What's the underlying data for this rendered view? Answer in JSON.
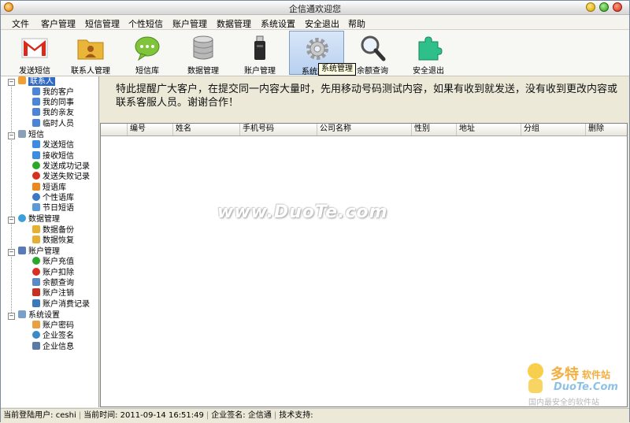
{
  "window": {
    "title": "企信通欢迎您"
  },
  "menu": [
    "文件",
    "客户管理",
    "短信管理",
    "个性短信",
    "账户管理",
    "数据管理",
    "系统设置",
    "安全退出",
    "帮助"
  ],
  "toolbar": [
    {
      "label": "发送短信",
      "icon": "gmail-m-icon"
    },
    {
      "label": "联系人管理",
      "icon": "contacts-folder-icon"
    },
    {
      "label": "短信库",
      "icon": "chat-bubble-icon"
    },
    {
      "label": "数据管理",
      "icon": "database-icon"
    },
    {
      "label": "账户管理",
      "icon": "usb-drive-icon"
    },
    {
      "label": "系统管理",
      "icon": "gear-icon"
    },
    {
      "label": "余额查询",
      "icon": "magnifier-icon"
    },
    {
      "label": "安全退出",
      "icon": "puzzle-icon"
    }
  ],
  "tooltip": "系统管理",
  "tree": {
    "groups": [
      {
        "label": "联系人",
        "icon": "contacts-group-icon",
        "children": [
          {
            "label": "我的客户",
            "icon": "person-icon"
          },
          {
            "label": "我的同事",
            "icon": "person-icon"
          },
          {
            "label": "我的亲友",
            "icon": "person-icon"
          },
          {
            "label": "临时人员",
            "icon": "person-icon"
          }
        ]
      },
      {
        "label": "短信",
        "icon": "envelope-icon",
        "children": [
          {
            "label": "发送短信",
            "icon": "send-icon"
          },
          {
            "label": "接收短信",
            "icon": "inbox-icon"
          },
          {
            "label": "发送成功记录",
            "icon": "check-icon"
          },
          {
            "label": "发送失败记录",
            "icon": "error-icon"
          },
          {
            "label": "短语库",
            "icon": "library-icon"
          },
          {
            "label": "个性语库",
            "icon": "custom-icon"
          },
          {
            "label": "节日短语",
            "icon": "calendar-icon"
          }
        ]
      },
      {
        "label": "数据管理",
        "icon": "data-icon",
        "children": [
          {
            "label": "数据备份",
            "icon": "backup-icon"
          },
          {
            "label": "数据恢复",
            "icon": "restore-icon"
          }
        ]
      },
      {
        "label": "账户管理",
        "icon": "account-icon",
        "children": [
          {
            "label": "账户充值",
            "icon": "add-icon"
          },
          {
            "label": "账户扣除",
            "icon": "minus-icon"
          },
          {
            "label": "余额查询",
            "icon": "grid-icon"
          },
          {
            "label": "账户注销",
            "icon": "cancel-icon"
          },
          {
            "label": "账户消费记录",
            "icon": "record-icon"
          }
        ]
      },
      {
        "label": "系统设置",
        "icon": "settings-icon",
        "children": [
          {
            "label": "账户密码",
            "icon": "pencil-icon"
          },
          {
            "label": "企业签名",
            "icon": "globe-icon"
          },
          {
            "label": "企业信息",
            "icon": "info-icon"
          }
        ]
      }
    ]
  },
  "notice": "特此提醒广大客户，在提交同一内容大量时，先用移动号码测试内容，如果有收到就发送，没有收到更改内容或联系客服人员。谢谢合作！",
  "grid": {
    "columns": [
      "",
      "编号",
      "姓名",
      "手机号码",
      "公司名称",
      "性别",
      "地址",
      "分组",
      "删除"
    ]
  },
  "watermark": "www.DuoTe.com",
  "corner_logo": {
    "brand": "多特",
    "suffix": "软件站",
    "site": "DuoTe.Com",
    "slogan": "国内最安全的软件站"
  },
  "status": {
    "user_label": "当前登陆用户:",
    "user": "ceshi",
    "time_label": "当前时间:",
    "time": "2011-09-14 16:51:49",
    "sign_label": "企业签名:",
    "sign": "企信通",
    "support_label": "技术支持:",
    "support": ""
  }
}
